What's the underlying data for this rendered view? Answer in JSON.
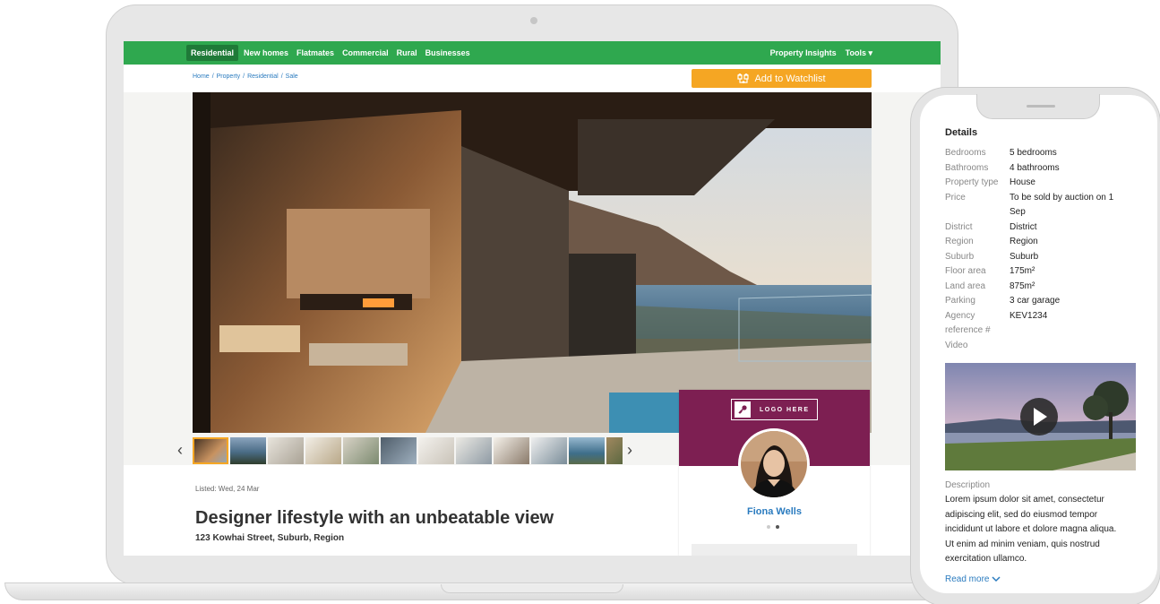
{
  "nav": {
    "left_items": [
      "Residential",
      "New homes",
      "Flatmates",
      "Commercial",
      "Rural",
      "Businesses"
    ],
    "right_items": [
      "Property Insights",
      "Tools ▾"
    ]
  },
  "breadcrumb": [
    "Home",
    "Property",
    "Residential",
    "Sale"
  ],
  "watchlist_label": "Add to Watchlist",
  "listing": {
    "listed": "Listed: Wed, 24 Mar",
    "title": "Designer lifestyle with an unbeatable view",
    "address": "123 Kowhai Street, Suburb, Region"
  },
  "agent": {
    "logo_text": "LOGO HERE",
    "name": "Fiona Wells"
  },
  "gallery": {
    "prev_arrow": "‹",
    "next_arrow": "›"
  },
  "mobile": {
    "details_heading": "Details",
    "details": [
      {
        "label": "Bedrooms",
        "value": "5 bedrooms"
      },
      {
        "label": "Bathrooms",
        "value": "4 bathrooms"
      },
      {
        "label": "Property type",
        "value": "House"
      },
      {
        "label": "Price",
        "value": "To be sold by auction on 1 Sep"
      },
      {
        "label": "District",
        "value": "District"
      },
      {
        "label": "Region",
        "value": "Region"
      },
      {
        "label": "Suburb",
        "value": "Suburb"
      },
      {
        "label": "Floor area",
        "value": "175m²"
      },
      {
        "label": "Land area",
        "value": "875m²"
      },
      {
        "label": "Parking",
        "value": "3 car garage"
      },
      {
        "label": "Agency reference #",
        "value": "KEV1234"
      },
      {
        "label": "Video",
        "value": ""
      }
    ],
    "description_heading": "Description",
    "description": "Lorem ipsum dolor sit amet, consectetur adipiscing elit, sed do eiusmod tempor incididunt ut labore et dolore magna aliqua. Ut enim ad minim veniam, quis nostrud exercitation ullamco.",
    "read_more": "Read more"
  },
  "colors": {
    "nav_green": "#2fa84f",
    "watchlist_orange": "#f5a623",
    "agent_purple": "#7d1f52",
    "link_blue": "#2a7bbf"
  }
}
